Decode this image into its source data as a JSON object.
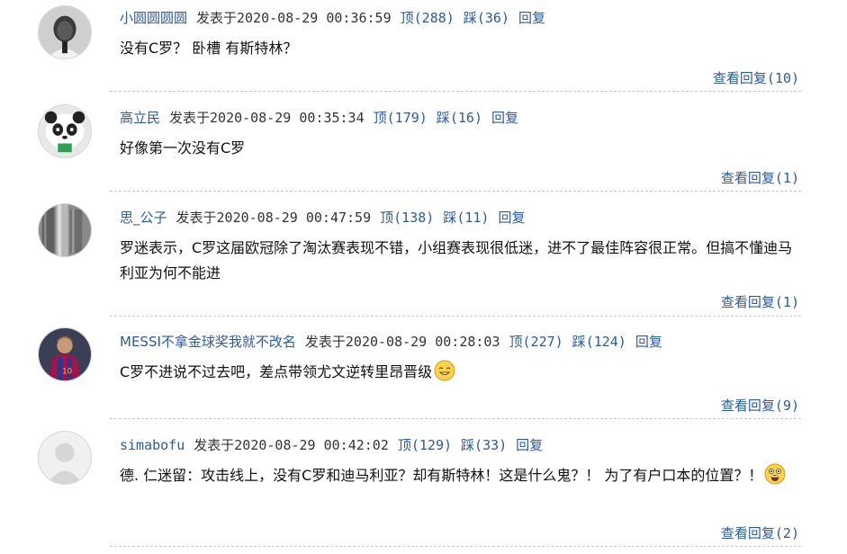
{
  "labels": {
    "posted_prefix": "发表于",
    "upvote": "顶",
    "downvote": "踩",
    "reply": "回复",
    "view_replies": "查看回复"
  },
  "comments": [
    {
      "user": "小圆圆圆圆",
      "time": "2020-08-29 00:36:59",
      "up": "(288)",
      "down": "(36)",
      "text": "没有C罗？ 卧槽 有斯特林？",
      "replies": "(10)",
      "avatar": "child-avatar"
    },
    {
      "user": "高立民",
      "time": "2020-08-29 00:35:34",
      "up": "(179)",
      "down": "(16)",
      "text": "好像第一次没有C罗",
      "replies": "(1)",
      "avatar": "panda-avatar"
    },
    {
      "user": "思_公子",
      "time": "2020-08-29 00:47:59",
      "up": "(138)",
      "down": "(11)",
      "text": "罗迷表示，C罗这届欧冠除了淘汰赛表现不错，小组赛表现很低迷，进不了最佳阵容很正常。但搞不懂迪马利亚为何不能进",
      "replies": "(1)",
      "avatar": "pipes-avatar"
    },
    {
      "user": "MESSI不拿金球奖我就不改名",
      "time": "2020-08-29 00:28:03",
      "up": "(227)",
      "down": "(124)",
      "text": "C罗不进说不过去吧，差点带领尤文逆转里昂晋级",
      "replies": "(9)",
      "avatar": "player-avatar",
      "emoji": "sweat-smile-emoji"
    },
    {
      "user": "simabofu",
      "time": "2020-08-29 00:42:02",
      "up": "(129)",
      "down": "(33)",
      "text": "德. 仁迷留：攻击线上，没有C罗和迪马利亚？却有斯特林！这是什么鬼？！ 为了有户口本的位置？！",
      "replies": "(2)",
      "avatar": "default-avatar",
      "emoji": "shocked-emoji"
    }
  ]
}
